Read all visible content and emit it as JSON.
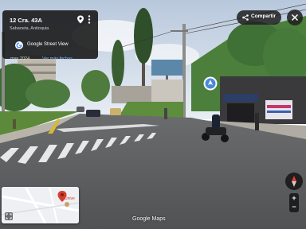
{
  "location": {
    "address": "12 Cra. 43A",
    "locality": "Sabaneta, Antioquia",
    "service_label": "Google Street View",
    "capture_date": "may 2024",
    "more_dates_label": "Ver más fechas"
  },
  "actions": {
    "share_label": "Compartir"
  },
  "minimap": {
    "place_label": "Unive"
  },
  "zoom": {
    "in_label": "+",
    "out_label": "−"
  },
  "watermark": "Google Maps",
  "shop_sign": "INVERSIONES LA MACARENA",
  "icons": {
    "location": "location-pin-icon",
    "more": "more-vert-icon",
    "streetview_logo": "google-logo-icon",
    "share": "share-icon",
    "close": "close-icon",
    "expand": "expand-icon",
    "compass": "compass-icon",
    "navigate": "navigation-arrow-icon"
  },
  "colors": {
    "card_bg": "#141414",
    "accent_link": "#8ab4f8",
    "map_pin": "#d23f31",
    "nav_marker": "#4a89dc"
  }
}
